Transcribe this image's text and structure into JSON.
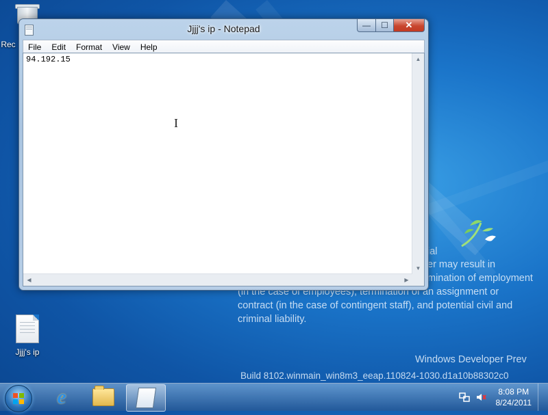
{
  "desktop": {
    "recycle_bin_label": "Rec",
    "file_icon_label": "Jjjj's ip",
    "watermark_lines": [
      "ial",
      "er may result in",
      "mination of employment",
      "(in the case of employees), termination of an assignment or",
      "contract (in the case of contingent staff), and potential civil and",
      "criminal liability."
    ],
    "os_name": "Windows Developer Prev",
    "build": "Build 8102.winmain_win8m3_eeap.110824-1030.d1a10b88302c0"
  },
  "window": {
    "title": "Jjjj's ip - Notepad",
    "menu": [
      "File",
      "Edit",
      "Format",
      "View",
      "Help"
    ],
    "content": "94.192.15",
    "buttons": {
      "min": "—",
      "max": "☐",
      "close": "✕"
    }
  },
  "taskbar": {
    "time": "8:08 PM",
    "date": "8/24/2011"
  }
}
